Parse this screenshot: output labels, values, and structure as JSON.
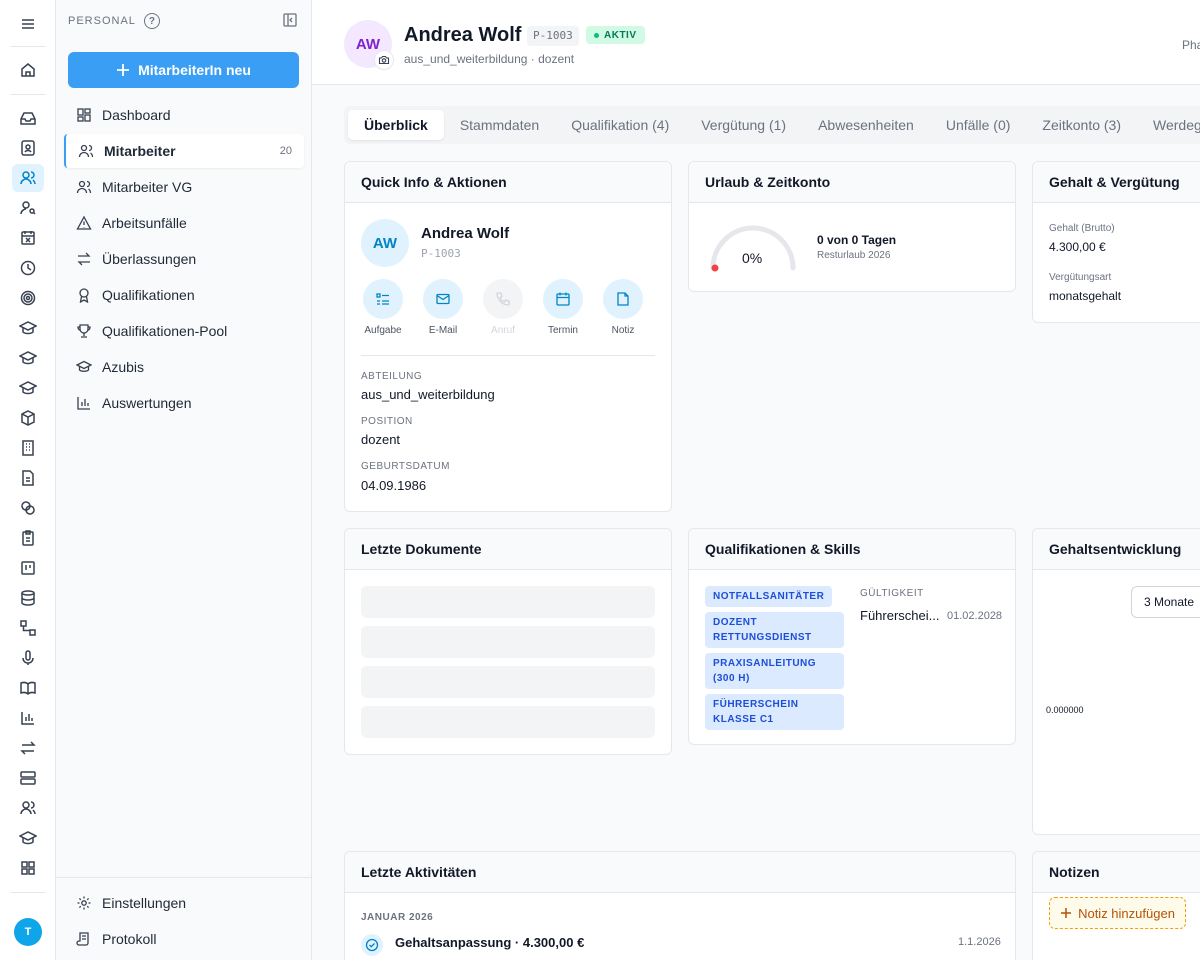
{
  "sidebar": {
    "section_label": "PERSONAL",
    "help_label": "?",
    "new_button_label": "MitarbeiterIn neu",
    "items": [
      {
        "label": "Dashboard",
        "icon": "dashboard-icon"
      },
      {
        "label": "Mitarbeiter",
        "icon": "users-icon",
        "count": "20",
        "active": true
      },
      {
        "label": "Mitarbeiter VG",
        "icon": "users-icon"
      },
      {
        "label": "Arbeitsunfälle",
        "icon": "warning-icon"
      },
      {
        "label": "Überlassungen",
        "icon": "arrows-icon"
      },
      {
        "label": "Qualifikationen",
        "icon": "award-icon"
      },
      {
        "label": "Qualifikationen-Pool",
        "icon": "trophy-icon"
      },
      {
        "label": "Azubis",
        "icon": "graduation-cap-icon"
      },
      {
        "label": "Auswertungen",
        "icon": "bar-chart-icon"
      }
    ],
    "footer": [
      {
        "label": "Einstellungen",
        "icon": "gear-icon"
      },
      {
        "label": "Protokoll",
        "icon": "scroll-icon"
      }
    ]
  },
  "user_avatar": "T",
  "header": {
    "initials": "AW",
    "name": "Andrea Wolf",
    "id": "P-1003",
    "status": "AKTIV",
    "subtitle": "aus_und_weiterbildung · dozent",
    "right_text": "Pha"
  },
  "tabs": [
    "Überblick",
    "Stammdaten",
    "Qualifikation (4)",
    "Vergütung (1)",
    "Abwesenheiten",
    "Unfälle (0)",
    "Zeitkonto (3)",
    "Werdegang ("
  ],
  "quick_info": {
    "title": "Quick Info & Aktionen",
    "initials": "AW",
    "name": "Andrea Wolf",
    "id": "P-1003",
    "actions": [
      "Aufgabe",
      "E-Mail",
      "Anruf",
      "Termin",
      "Notiz"
    ],
    "fields": [
      {
        "label": "ABTEILUNG",
        "value": "aus_und_weiterbildung"
      },
      {
        "label": "POSITION",
        "value": "dozent"
      },
      {
        "label": "GEBURTSDATUM",
        "value": "04.09.1986"
      }
    ]
  },
  "vacation": {
    "title": "Urlaub & Zeitkonto",
    "percent": "0%",
    "progress": 0,
    "days_text": "0 von 0 Tagen",
    "sub": "Resturlaub 2026",
    "accent": "#ef4444"
  },
  "salary": {
    "title": "Gehalt & Vergütung",
    "gross_label": "Gehalt (Brutto)",
    "gross_value": "4.300,00 €",
    "type_label": "Vergütungsart",
    "type_value": "monatsgehalt"
  },
  "documents": {
    "title": "Letzte Dokumente"
  },
  "skills": {
    "title": "Qualifikationen & Skills",
    "chips": [
      "NOTFALLSANITÄTER",
      "DOZENT RETTUNGSDIENST",
      "PRAXISANLEITUNG (300 H)",
      "FÜHRERSCHEIN KLASSE C1"
    ],
    "validity_label": "GÜLTIGKEIT",
    "validity_item": "Führerschei...",
    "validity_date": "01.02.2028"
  },
  "salary_dev": {
    "title": "Gehaltsentwicklung",
    "period": "3 Monate",
    "axis_value": "0.000000"
  },
  "activities": {
    "title": "Letzte Aktivitäten",
    "month": "JANUAR 2026",
    "item": "Gehaltsanpassung · 4.300,00 €",
    "date": "1.1.2026"
  },
  "notes": {
    "title": "Notizen",
    "add_label": "Notiz hinzufügen"
  }
}
